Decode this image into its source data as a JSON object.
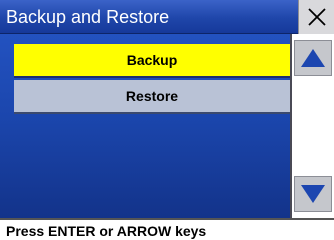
{
  "window": {
    "title": "Backup and Restore",
    "close_icon": "close-icon"
  },
  "menu": {
    "items": [
      {
        "label": "Backup",
        "selected": true
      },
      {
        "label": "Restore",
        "selected": false
      }
    ]
  },
  "scrollbar": {
    "up_icon": "up-arrow-icon",
    "down_icon": "down-arrow-icon"
  },
  "status": {
    "text": "Press ENTER or ARROW keys"
  },
  "colors": {
    "selected_item": "#ffff00",
    "unselected_item": "#b9c2d6",
    "background": "#1c3f93",
    "arrow": "#1c46b0"
  }
}
